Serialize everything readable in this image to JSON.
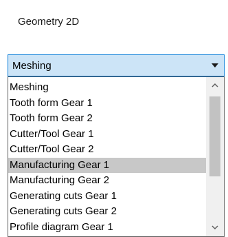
{
  "panel": {
    "title": "Geometry 2D"
  },
  "combo": {
    "selected_value": "Meshing",
    "arrow_icon": "chevron-down-icon",
    "accent_color": "#0078d7",
    "fill_color": "#cce4f7"
  },
  "dropdown": {
    "items": [
      {
        "label": "Meshing"
      },
      {
        "label": "Tooth form Gear 1"
      },
      {
        "label": "Tooth form Gear 2"
      },
      {
        "label": "Cutter/Tool Gear 1"
      },
      {
        "label": "Cutter/Tool Gear 2"
      },
      {
        "label": "Manufacturing Gear 1"
      },
      {
        "label": "Manufacturing Gear 2"
      },
      {
        "label": "Generating cuts Gear 1"
      },
      {
        "label": "Generating cuts Gear 2"
      },
      {
        "label": "Profile diagram Gear 1"
      }
    ],
    "highlighted_item": "Manufacturing Gear 1",
    "highlight_color": "#c8c8c8",
    "scrollbar": {
      "up_icon": "chevron-up-icon",
      "down_icon": "chevron-down-icon"
    }
  }
}
